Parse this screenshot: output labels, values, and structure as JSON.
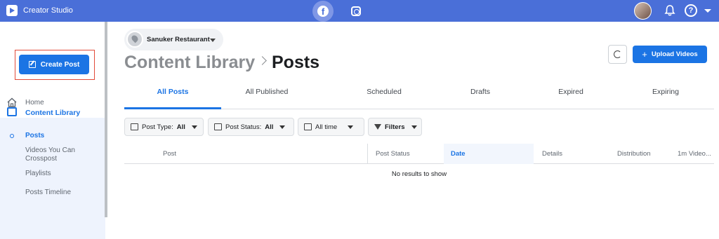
{
  "app": {
    "title": "Creator Studio"
  },
  "topbar": {
    "platforms": [
      {
        "icon": "facebook-icon",
        "active": true
      },
      {
        "icon": "instagram-icon",
        "active": false
      }
    ],
    "icons": [
      "avatar",
      "bell-icon",
      "help-icon",
      "caret-down-icon"
    ]
  },
  "colors": {
    "brand": "#4a6fd8",
    "primary": "#1b74e4",
    "highlight": "#e24b39"
  },
  "sidebar": {
    "create_post_label": "Create Post",
    "home_label": "Home",
    "section_label": "Content Library",
    "items": [
      {
        "label": "Posts",
        "active": true
      },
      {
        "label": "Videos You Can Crosspost",
        "active": false
      },
      {
        "label": "Playlists",
        "active": false
      },
      {
        "label": "Posts Timeline",
        "active": false
      }
    ]
  },
  "page_selector": {
    "name": "Sanuker Restaurant"
  },
  "breadcrumb": {
    "root": "Content Library",
    "current": "Posts"
  },
  "actions": {
    "upload_label": "Upload Videos"
  },
  "tabs": [
    {
      "label": "All Posts",
      "active": true
    },
    {
      "label": "All Published",
      "active": false
    },
    {
      "label": "Scheduled",
      "active": false
    },
    {
      "label": "Drafts",
      "active": false
    },
    {
      "label": "Expired",
      "active": false
    },
    {
      "label": "Expiring",
      "active": false
    }
  ],
  "filters": {
    "post_type": {
      "label": "Post Type:",
      "value": "All"
    },
    "post_status": {
      "label": "Post Status:",
      "value": "All"
    },
    "time": {
      "value": "All time"
    },
    "more": {
      "label": "Filters"
    }
  },
  "table": {
    "columns": [
      "Post",
      "Post Status",
      "Date",
      "Details",
      "Distribution",
      "1m Video..."
    ],
    "sorted_column": "Date",
    "empty_message": "No results to show"
  }
}
